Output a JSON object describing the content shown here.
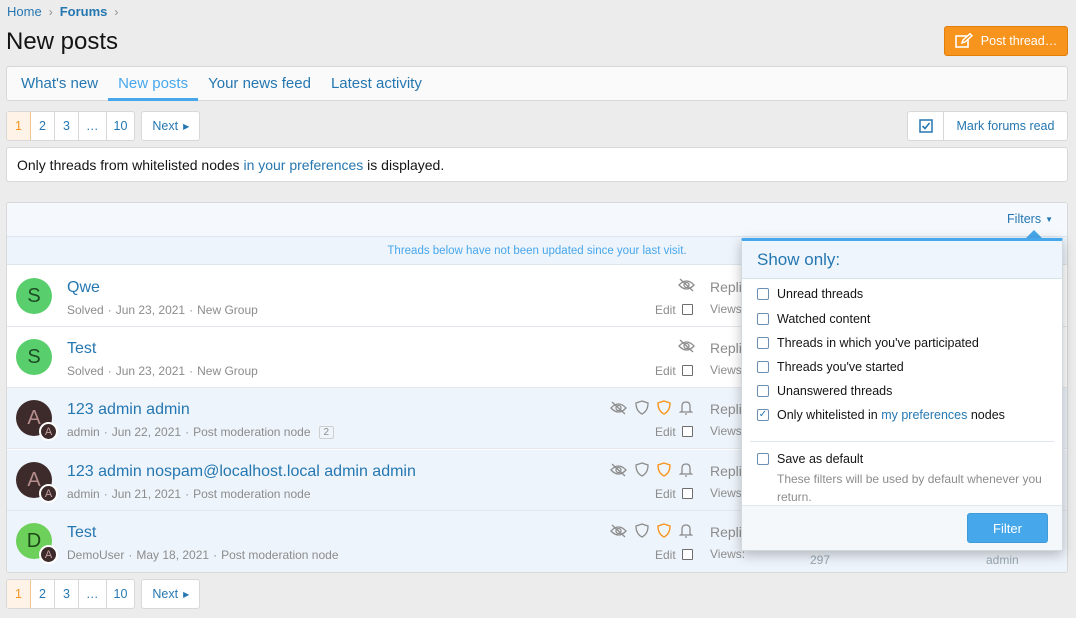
{
  "breadcrumb": {
    "home": "Home",
    "forums": "Forums"
  },
  "page": {
    "title": "New posts",
    "post_thread": "Post thread…"
  },
  "tabs": [
    "What's new",
    "New posts",
    "Your news feed",
    "Latest activity"
  ],
  "pagination": {
    "pages": [
      "1",
      "2",
      "3",
      "…",
      "10"
    ],
    "current": "1",
    "next": "Next"
  },
  "mark_read": "Mark forums read",
  "notice": {
    "before": "Only threads from whitelisted nodes ",
    "link": "in your preferences",
    "after": " is displayed."
  },
  "filters_label": "Filters",
  "unread_divider": "Threads below have not been updated since your last visit.",
  "threads": [
    {
      "avatar": "S",
      "title": "Qwe",
      "author": "Solved",
      "date": "Jun 23, 2021",
      "node": "New Group",
      "edit": "Edit",
      "stat1": "Repli",
      "stat2": "Views:"
    },
    {
      "avatar": "S",
      "title": "Test",
      "author": "Solved",
      "date": "Jun 23, 2021",
      "node": "New Group",
      "edit": "Edit",
      "stat1": "Repli",
      "stat2": "Views:"
    },
    {
      "avatar": "A",
      "avatar_sub": "A",
      "title": "123 admin admin",
      "author": "admin",
      "date": "Jun 22, 2021",
      "node": "Post moderation node",
      "pages": "2",
      "edit": "Edit",
      "stat1": "Repli",
      "stat2": "Views:"
    },
    {
      "avatar": "A",
      "avatar_sub": "A",
      "title": "123 admin nospam@localhost.local admin admin",
      "author": "admin",
      "date": "Jun 21, 2021",
      "node": "Post moderation node",
      "edit": "Edit",
      "stat1": "Repli",
      "stat2": "Views:"
    },
    {
      "avatar": "D",
      "avatar_sub": "A",
      "title": "Test",
      "author": "DemoUser",
      "date": "May 18, 2021",
      "node": "Post moderation node",
      "edit": "Edit",
      "stat1": "Repli",
      "stat2": "Views:",
      "faint_views": "297",
      "faint_user": "admin"
    }
  ],
  "filter_popup": {
    "heading": "Show only:",
    "options": [
      {
        "label": "Unread threads",
        "checked": false
      },
      {
        "label": "Watched content",
        "checked": false
      },
      {
        "label": "Threads in which you've participated",
        "checked": false
      },
      {
        "label": "Threads you've started",
        "checked": false
      },
      {
        "label": "Unanswered threads",
        "checked": false
      },
      {
        "label_before": "Only whitelisted in ",
        "label_link": "my preferences",
        "label_after": " nodes",
        "checked": true
      }
    ],
    "save_default": "Save as default",
    "hint": "These filters will be used by default whenever you return.",
    "button": "Filter"
  },
  "colors": {
    "accent": "#47a7eb",
    "link": "#2577b1",
    "cta": "#f7941d",
    "current_page": "#f7941d"
  },
  "icons": [
    "chevron-right-icon",
    "edit-icon",
    "checkbox-icon",
    "eye-slash-icon",
    "shield-icon",
    "bell-icon",
    "caret-down-icon",
    "caret-right-icon"
  ]
}
